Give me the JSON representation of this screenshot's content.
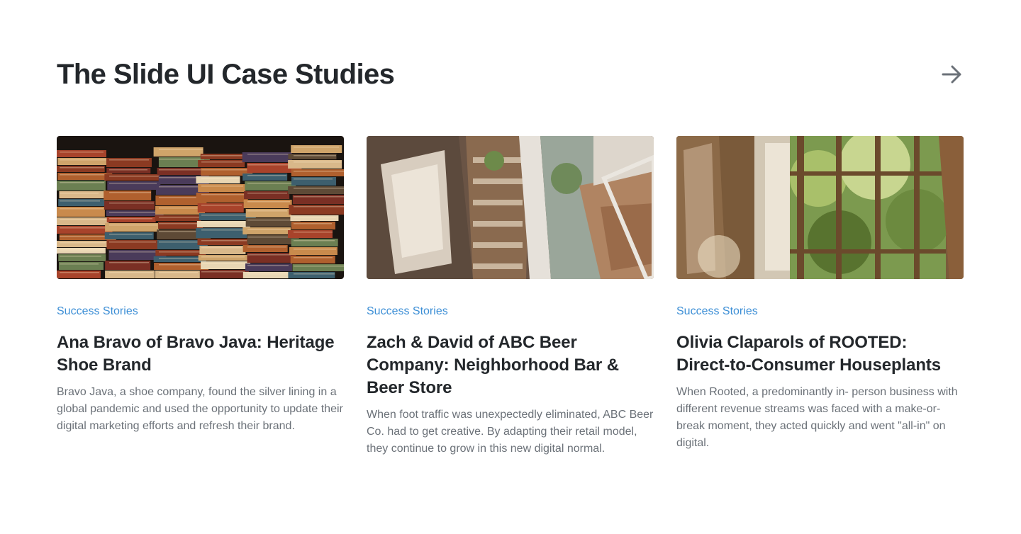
{
  "section": {
    "title": "The Slide UI Case Studies",
    "next_icon": "arrow-right-icon"
  },
  "cards": [
    {
      "category": "Success Stories",
      "title": "Ana Bravo of Bravo Java: Heritage Shoe Brand",
      "description": "Bravo Java, a shoe company, found the silver lining in a global pandemic and used the opportunity to update their digital marketing efforts and refresh their brand.",
      "image": "stacked-books-image"
    },
    {
      "category": "Success Stories",
      "title": "Zach & David of ABC Beer Company: Neighborhood Bar & Beer Store",
      "description": "When foot traffic was unexpectedly eliminated, ABC Beer Co. had to get creative. By adapting their retail model, they continue to grow in this new digital normal.",
      "image": "interior-staircase-image"
    },
    {
      "category": "Success Stories",
      "title": "Olivia Claparols of ROOTED: Direct-to-Consumer Houseplants",
      "description": "When Rooted, a predominantly in- person business with different revenue streams was faced with a make-or-break moment, they acted quickly and went \"all-in\" on digital.",
      "image": "sunroom-plants-image"
    }
  ],
  "colors": {
    "category": "#3d8fd6",
    "title": "#23272b",
    "body": "#6b7178"
  }
}
